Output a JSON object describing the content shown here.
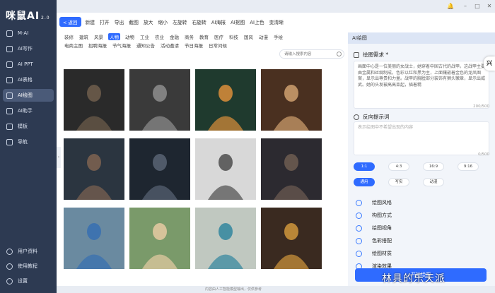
{
  "app": {
    "logo": "咪鼠AI",
    "version": "2.0"
  },
  "sidebar": {
    "items": [
      {
        "label": "M-AI",
        "icon": "grid-icon"
      },
      {
        "label": "AI写作",
        "icon": "pen-icon"
      },
      {
        "label": "AI PPT",
        "icon": "slides-icon"
      },
      {
        "label": "AI表格",
        "icon": "table-icon"
      },
      {
        "label": "AI绘图",
        "icon": "paint-icon",
        "active": true
      },
      {
        "label": "AI助手",
        "icon": "robot-icon"
      },
      {
        "label": "模板",
        "icon": "template-icon"
      },
      {
        "label": "导航",
        "icon": "compass-icon"
      }
    ],
    "bottom": [
      {
        "label": "用户资料",
        "icon": "user-icon"
      },
      {
        "label": "使用教程",
        "icon": "help-icon"
      },
      {
        "label": "设置",
        "icon": "gear-icon"
      }
    ]
  },
  "toolbar": {
    "back": "< 返回",
    "items": [
      "新建",
      "打开",
      "导出",
      "截图",
      "放大",
      "缩小",
      "左旋转",
      "右旋转",
      "AI海报",
      "AI抠图",
      "AI上色",
      "变清晰"
    ]
  },
  "categories": {
    "row1": [
      "装修",
      "建筑",
      "风景",
      "人物",
      "动物",
      "工业",
      "农业",
      "金融",
      "商务",
      "教育",
      "医疗",
      "科技",
      "国风",
      "动漫",
      "手绘"
    ],
    "active": "人物",
    "row2": [
      "电商主图",
      "招聘海报",
      "节气海报",
      "通知公告",
      "活动邀请",
      "节日海报",
      "日常问候"
    ]
  },
  "search": {
    "placeholder": "请输入搜索内容"
  },
  "panel": {
    "title": "AI绘图",
    "prompt_label": "绘图需求 *",
    "prompt_text": "画面中心是一位美丽的女战士，她穿着中国古代的战甲。这战甲主要由金属和丝绸制成，色彩以红和黑为主，上面镶嵌着金色的龙凤图案，显示出尊贵和力量。战甲的胸膛部分装饰有狮头徽章，显示出威武。她的头发被高高束起，插着精",
    "prompt_count": "200/500",
    "negative_label": "反向提示词",
    "negative_placeholder": "表示绘图中不希望出现的内容",
    "negative_count": "0/500",
    "ratios": [
      "1:1",
      "4:3",
      "16:9",
      "9:16"
    ],
    "active_ratio": "1:1",
    "modes": [
      "通用",
      "写实",
      "动漫"
    ],
    "active_mode": "通用",
    "options": [
      "绘图风格",
      "构图方式",
      "绘图视角",
      "色彩搭配",
      "绘图材质",
      "渲染效果"
    ],
    "generate": "开始绘图"
  },
  "footer": "内容由人工智能模型输出，仅供参考",
  "watermark": "林具的乐天派"
}
